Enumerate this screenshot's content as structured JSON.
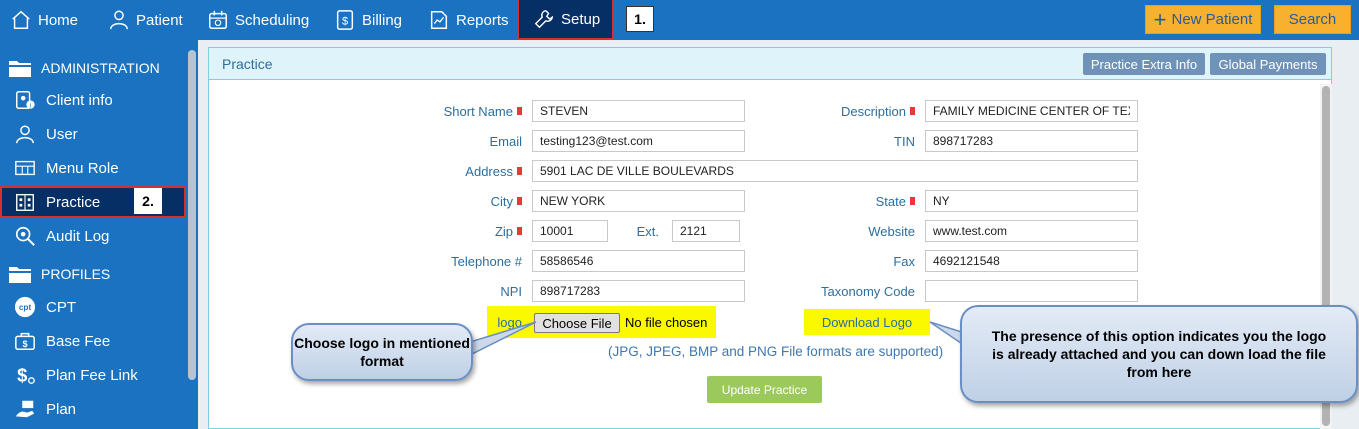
{
  "nav": {
    "items": [
      {
        "label": "Home",
        "icon": "home-icon"
      },
      {
        "label": "Patient",
        "icon": "user-icon"
      },
      {
        "label": "Scheduling",
        "icon": "calendar-icon"
      },
      {
        "label": "Billing",
        "icon": "dollar-icon"
      },
      {
        "label": "Reports",
        "icon": "chart-icon"
      },
      {
        "label": "Setup",
        "icon": "wrench-icon"
      }
    ],
    "callout": "1.",
    "new_patient": "New Patient",
    "search": "Search"
  },
  "sidebar": {
    "section_admin": "ADMINISTRATION",
    "items_admin": [
      {
        "label": "Client info"
      },
      {
        "label": "User"
      },
      {
        "label": "Menu Role"
      },
      {
        "label": "Practice"
      },
      {
        "label": "Audit Log"
      }
    ],
    "callout": "2.",
    "section_profiles": "PROFILES",
    "items_profiles": [
      {
        "label": "CPT"
      },
      {
        "label": "Base Fee"
      },
      {
        "label": "Plan Fee Link"
      },
      {
        "label": "Plan"
      }
    ]
  },
  "panel": {
    "title": "Practice",
    "extra_info_button": "Practice Extra Info",
    "global_payments_button": "Global Payments"
  },
  "form": {
    "short_name": {
      "label": "Short Name",
      "value": "STEVEN"
    },
    "description": {
      "label": "Description",
      "value": "FAMILY MEDICINE CENTER OF TEXA"
    },
    "email": {
      "label": "Email",
      "value": "testing123@test.com"
    },
    "tin": {
      "label": "TIN",
      "value": "898717283"
    },
    "address": {
      "label": "Address",
      "value": "5901 LAC DE VILLE BOULEVARDS"
    },
    "city": {
      "label": "City",
      "value": "NEW YORK"
    },
    "state": {
      "label": "State",
      "value": "NY"
    },
    "zip": {
      "label": "Zip",
      "value": "10001"
    },
    "ext": {
      "label": "Ext.",
      "value": "2121"
    },
    "website": {
      "label": "Website",
      "value": "www.test.com"
    },
    "telephone": {
      "label": "Telephone #",
      "value": "58586546"
    },
    "fax": {
      "label": "Fax",
      "value": "4692121548"
    },
    "npi": {
      "label": "NPI",
      "value": "898717283"
    },
    "taxonomy": {
      "label": "Taxonomy Code",
      "value": ""
    },
    "logo_label": "logo",
    "choose_file": "Choose File",
    "no_file": "No file chosen",
    "download_logo": "Download Logo",
    "formats_note": "(JPG, JPEG, BMP and PNG File formats are supported)",
    "update_button": "Update Practice"
  },
  "annotations": {
    "choose_logo": "Choose logo in mentioned format",
    "download_note": "The presence of this option indicates you the logo is already attached and you can down load the file from here"
  },
  "colors": {
    "nav_blue": "#1a72c0",
    "active_dark": "#062f66",
    "highlight_red": "#d6312f",
    "orange": "#f7b12f",
    "green_button": "#9cc95b",
    "highlight_yellow": "#fbf900"
  }
}
